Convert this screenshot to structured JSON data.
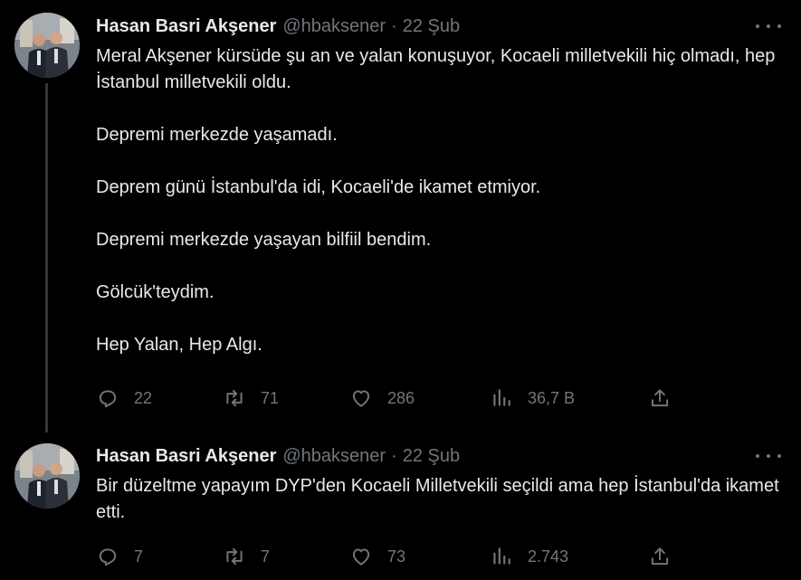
{
  "tweets": [
    {
      "author_name": "Hasan Basri Akşener",
      "handle": "@hbaksener",
      "separator": "·",
      "time": "22 Şub",
      "paragraphs": [
        "Meral Akşener kürsüde şu an ve yalan konuşuyor, Kocaeli milletvekili hiç olmadı, hep İstanbul milletvekili oldu.",
        "Depremi merkezde yaşamadı.",
        "Deprem günü İstanbul'da idi, Kocaeli'de ikamet etmiyor.",
        "Depremi merkezde yaşayan bilfiil bendim.",
        "Gölcük'teydim.",
        "Hep Yalan, Hep Algı."
      ],
      "replies": "22",
      "reposts": "71",
      "likes": "286",
      "views": "36,7 B"
    },
    {
      "author_name": "Hasan Basri Akşener",
      "handle": "@hbaksener",
      "separator": "·",
      "time": "22 Şub",
      "paragraphs": [
        "Bir düzeltme yapayım DYP'den Kocaeli Milletvekili seçildi ama hep İstanbul'da ikamet etti."
      ],
      "replies": "7",
      "reposts": "7",
      "likes": "73",
      "views": "2.743"
    }
  ],
  "icons": {
    "reply": "reply-icon",
    "repost": "repost-icon",
    "like": "heart-icon",
    "views": "views-chart-icon",
    "share": "share-icon",
    "more": "more-dots-icon"
  },
  "colors": {
    "background": "#000000",
    "text": "#e7e9ea",
    "secondary": "#71767b",
    "thread_line": "#333639"
  }
}
